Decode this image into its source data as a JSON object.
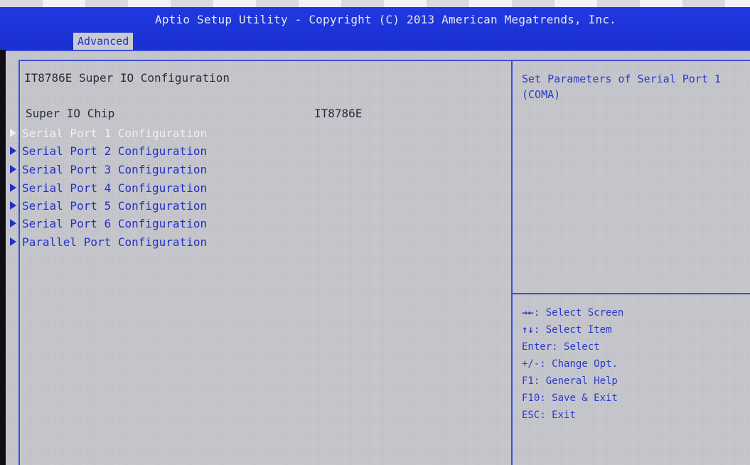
{
  "header": {
    "title": "Aptio Setup Utility - Copyright (C) 2013 American Megatrends, Inc.",
    "active_tab": "Advanced"
  },
  "page": {
    "title": "IT8786E Super IO Configuration",
    "super_io_chip": {
      "label": "Super IO Chip",
      "value": "IT8786E"
    },
    "items": [
      {
        "label": "Serial Port 1 Configuration",
        "selected": true
      },
      {
        "label": "Serial Port 2 Configuration",
        "selected": false
      },
      {
        "label": "Serial Port 3 Configuration",
        "selected": false
      },
      {
        "label": "Serial Port 4 Configuration",
        "selected": false
      },
      {
        "label": "Serial Port 5 Configuration",
        "selected": false
      },
      {
        "label": "Serial Port 6 Configuration",
        "selected": false
      },
      {
        "label": "Parallel Port Configuration",
        "selected": false
      }
    ]
  },
  "help": {
    "text": "Set Parameters of Serial Port 1 (COMA)"
  },
  "keys": [
    {
      "key": "→←",
      "desc": ": Select Screen"
    },
    {
      "key": "↑↓",
      "desc": ": Select Item"
    },
    {
      "key": "Enter",
      "desc": ": Select"
    },
    {
      "key": "+/-",
      "desc": ": Change Opt."
    },
    {
      "key": "F1",
      "desc": ": General Help"
    },
    {
      "key": "F10",
      "desc": ": Save & Exit"
    },
    {
      "key": "ESC",
      "desc": ": Exit"
    }
  ],
  "colors": {
    "header_blue": "#1b33d6",
    "panel_gray": "#c5c6cc",
    "item_blue": "#2130c8",
    "selected_white": "#eef0f6"
  }
}
